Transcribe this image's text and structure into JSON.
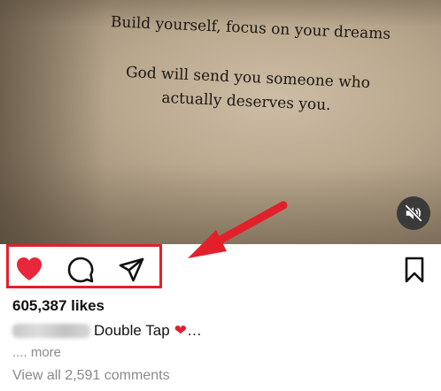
{
  "media": {
    "quote_line_1": "Build yourself, focus on your dreams",
    "quote_line_2": "God will send you someone who",
    "quote_line_3": "actually deserves you.",
    "mute_icon": "speaker-muted-icon"
  },
  "actions": {
    "like_icon": "heart-filled-icon",
    "comment_icon": "comment-bubble-icon",
    "share_icon": "paper-plane-icon",
    "save_icon": "bookmark-icon",
    "like_color": "#e8263c"
  },
  "annotation": {
    "color": "#e3202a"
  },
  "post": {
    "likes_text": "605,387 likes",
    "caption_text": "Double Tap",
    "caption_suffix": "…",
    "more_text": ".... more",
    "comments_text": "View all 2,591 comments"
  }
}
